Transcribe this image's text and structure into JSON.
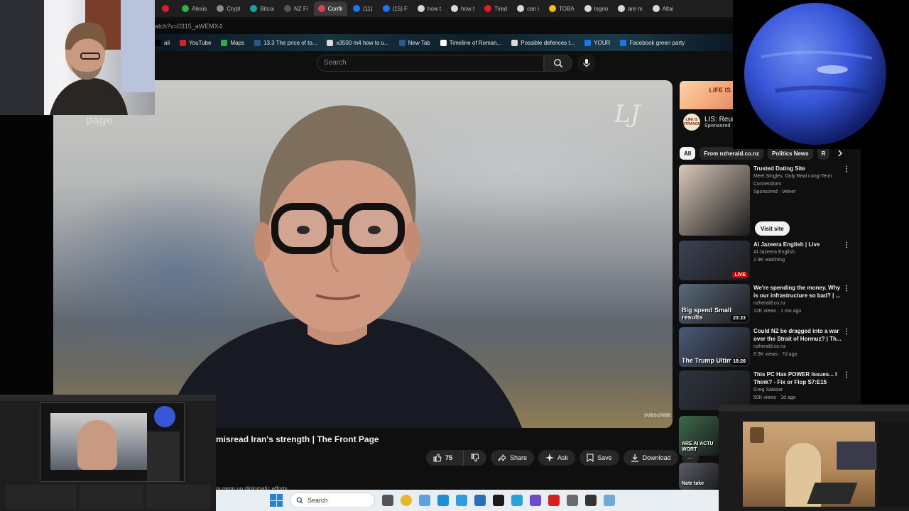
{
  "browser": {
    "tabs": [
      {
        "label": "",
        "color": "#e5192a",
        "active": false
      },
      {
        "label": "Alexis",
        "color": "#2fb14a",
        "active": false
      },
      {
        "label": "Crypt",
        "color": "#8a8a8a",
        "active": false
      },
      {
        "label": "Bitcoi",
        "color": "#1aa3a3",
        "active": false
      },
      {
        "label": "NZ Fi",
        "color": "#555555",
        "active": false
      },
      {
        "label": "Confir",
        "color": "#e5404d",
        "active": true
      },
      {
        "label": "(11)",
        "color": "#1877f2",
        "active": false
      },
      {
        "label": "(15) F",
        "color": "#1877f2",
        "active": false
      },
      {
        "label": "how t",
        "color": "#d9d9d9",
        "active": false
      },
      {
        "label": "how t",
        "color": "#d9d9d9",
        "active": false
      },
      {
        "label": "Tired",
        "color": "#e5192a",
        "active": false
      },
      {
        "label": "can i",
        "color": "#d9d9d9",
        "active": false
      },
      {
        "label": "TOBA",
        "color": "#f2c200",
        "active": false
      },
      {
        "label": "logno",
        "color": "#d9d9d9",
        "active": false
      },
      {
        "label": "are m",
        "color": "#d9d9d9",
        "active": false
      },
      {
        "label": "Altai",
        "color": "#d9d9d9",
        "active": false
      }
    ],
    "url": "atch?v=0315_aWEMX4",
    "bookmarks": [
      {
        "label": "ail",
        "color": "#000000"
      },
      {
        "label": "YouTube",
        "color": "#e5192a"
      },
      {
        "label": "Maps",
        "color": "#34a853"
      },
      {
        "label": "13.3 The price of to...",
        "color": "#2b5a8a"
      },
      {
        "label": "x3500 m4 how to u...",
        "color": "#d9d9d9"
      },
      {
        "label": "New Tab",
        "color": "#2b5a8a"
      },
      {
        "label": "Timeline of Roman...",
        "color": "#ffffff"
      },
      {
        "label": "Possible defences t...",
        "color": "#d9d9d9"
      },
      {
        "label": "YOUR",
        "color": "#1877f2"
      },
      {
        "label": "Facebook green party",
        "color": "#1877f2"
      }
    ]
  },
  "youtube": {
    "search_placeholder": "Search",
    "video": {
      "watermark": "LJ",
      "subscribe_watermark": "SUBSCRIBE",
      "page_watermark": "page",
      "title": "misread Iran's strength | The Front Page",
      "description_peek": "rs ramp up diplomatic efforts"
    },
    "actions": {
      "likes": "75",
      "share": "Share",
      "ask": "Ask",
      "save": "Save",
      "download": "Download",
      "more": "⋯"
    },
    "ad": {
      "banner_text": "LIFE IS",
      "logo_text": "LIFE IS STRANGE",
      "name": "LIS: Reun",
      "sponsored": "Sponsored"
    },
    "chips": [
      "All",
      "From nzherald.co.nz",
      "Politics News",
      "R"
    ],
    "recommendations": [
      {
        "title": "Trusted Dating Site",
        "line2": "Meet Singles. Only Real Long-Term Connections",
        "line3": "Sponsored · Velvet",
        "badge": "",
        "caption": "",
        "thumb": "#d8c8b8",
        "button": "Visit site"
      },
      {
        "title": "Al Jazeera English | Live",
        "line2": "Al Jazeera English",
        "line3": "2.9K watching",
        "badge": "LIVE",
        "caption": "",
        "thumb": "#3b4456",
        "button": ""
      },
      {
        "title": "We're spending the money. Why is our infrastructure so bad? | ...",
        "line2": "nzherald.co.nz",
        "line3": "12K views · 1 mo ago",
        "badge": "23:23",
        "caption": "Big spend Small results",
        "thumb": "#5a6b7c",
        "button": ""
      },
      {
        "title": "Could NZ be dragged into a war over the Strait of Hormuz? | Th...",
        "line2": "nzherald.co.nz",
        "line3": "8.9K views · 7d ago",
        "badge": "18:26",
        "caption": "The Trump Ultimatum",
        "thumb": "#4a5a78",
        "button": ""
      },
      {
        "title": "This PC Has POWER Issues... I Think? - Fix or Flop S7:E15",
        "line2": "Greg Salazar",
        "line3": "50K views · 1d ago",
        "badge": "",
        "caption": "",
        "thumb": "#2d3440",
        "button": ""
      }
    ],
    "rec_extra": [
      {
        "caption": "ARE AI ACTU WORT",
        "thumb": "#3d6b4a"
      },
      {
        "caption": "Nate take",
        "thumb": "#5a5e66"
      }
    ]
  },
  "taskbar": {
    "search": "Search",
    "icons": [
      {
        "name": "task-view",
        "color": "#555555"
      },
      {
        "name": "chrome",
        "color": "#e9b52a"
      },
      {
        "name": "copilot",
        "color": "#5ba3e0"
      },
      {
        "name": "edge",
        "color": "#1d8fd6"
      },
      {
        "name": "edge-dev",
        "color": "#2f9de0"
      },
      {
        "name": "store",
        "color": "#2b6fb8"
      },
      {
        "name": "spotify",
        "color": "#1a1a1a"
      },
      {
        "name": "telegram",
        "color": "#2aa1da"
      },
      {
        "name": "app-purple",
        "color": "#6b4bd0"
      },
      {
        "name": "acrobat",
        "color": "#d8201f"
      },
      {
        "name": "settings",
        "color": "#6b6b6b"
      },
      {
        "name": "obs",
        "color": "#333333"
      },
      {
        "name": "photos",
        "color": "#6fa8dc"
      }
    ]
  },
  "colors": {
    "accent_red": "#cc0000",
    "bg": "#0f0f0f",
    "chip_bg": "#272727"
  }
}
